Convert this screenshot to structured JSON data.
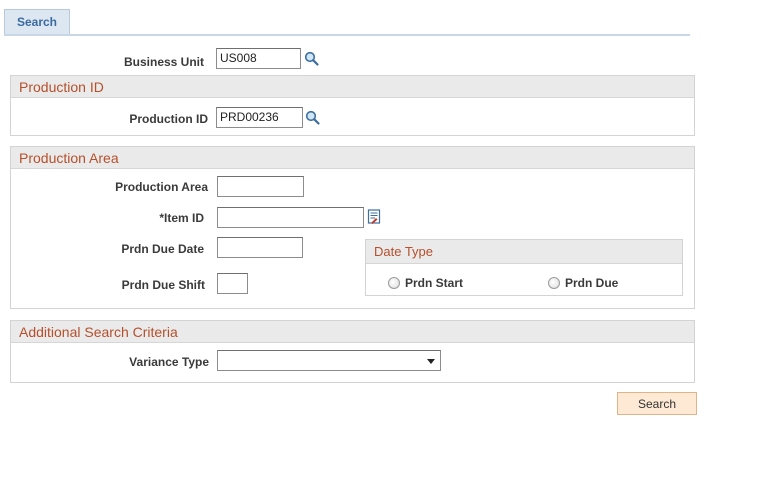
{
  "tab": {
    "label": "Search"
  },
  "business_unit": {
    "label": "Business Unit",
    "value": "US008"
  },
  "production_id_group": {
    "title": "Production ID",
    "label": "Production ID",
    "value": "PRD00236"
  },
  "production_area_group": {
    "title": "Production Area",
    "area_label": "Production Area",
    "area_value": "",
    "item_label": "*Item ID",
    "item_value": "",
    "due_date_label": "Prdn Due Date",
    "due_date_value": "",
    "due_shift_label": "Prdn Due Shift",
    "due_shift_value": "",
    "date_type": {
      "title": "Date Type",
      "options": [
        "Prdn Start",
        "Prdn Due"
      ]
    }
  },
  "additional_group": {
    "title": "Additional Search Criteria",
    "variance_label": "Variance Type",
    "variance_value": ""
  },
  "search_button": {
    "label": "Search"
  },
  "icons": {
    "lookup": "magnifier-lookup-icon",
    "item_lookup": "item-lookup-icon"
  }
}
